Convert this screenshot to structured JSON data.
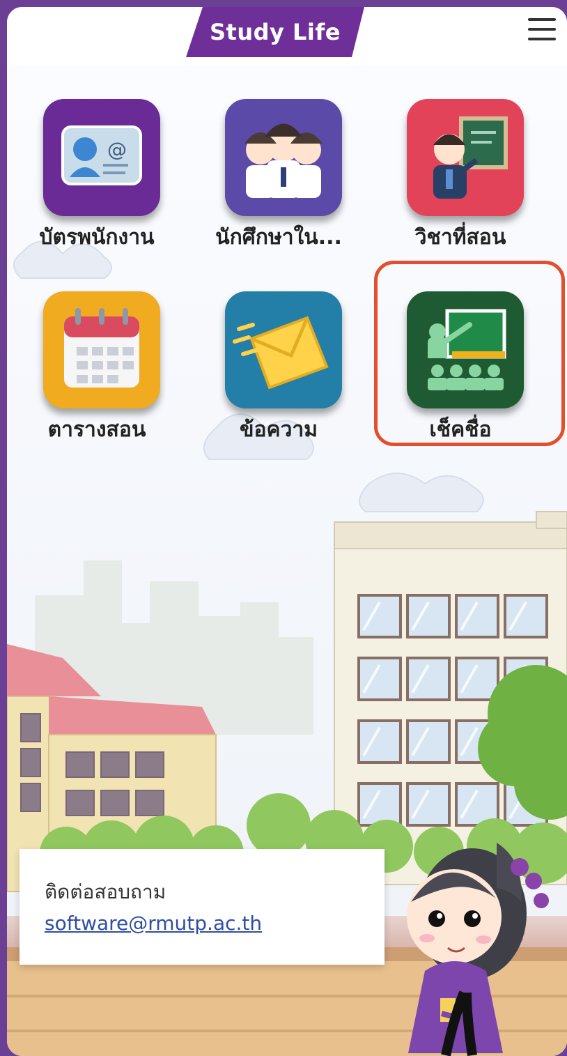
{
  "header": {
    "title": "Study Life",
    "menu_icon": "hamburger-menu-icon"
  },
  "apps": [
    {
      "label": "บัตรพนักงาน",
      "icon": "employee-card-icon",
      "color": "#6b2b96"
    },
    {
      "label": "นักศึกษาใน...",
      "icon": "students-icon",
      "color": "#5b4aa8"
    },
    {
      "label": "วิชาที่สอน",
      "icon": "teacher-board-icon",
      "color": "#e34359"
    },
    {
      "label": "ตารางสอน",
      "icon": "calendar-icon",
      "color": "#f0ab21"
    },
    {
      "label": "ข้อความ",
      "icon": "message-envelope-icon",
      "color": "#237fa8"
    },
    {
      "label": "เช็คชื่อ",
      "icon": "attendance-class-icon",
      "color": "#1e5a32"
    }
  ],
  "contact": {
    "title": "ติดต่อสอบถาม",
    "email": "software@rmutp.ac.th"
  },
  "highlight_color": "#e34e2c"
}
